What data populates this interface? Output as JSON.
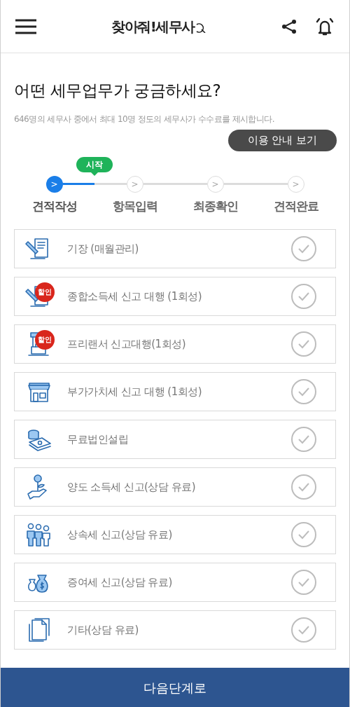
{
  "header": {
    "logo": "찾아줘!세무사"
  },
  "heading": "어떤 세무업무가 궁금하세요?",
  "subtitle": "646명의 세무사 중에서 최대 10명 정도의 세무사가 수수료를 제시합니다.",
  "guide_button": "이용 안내 보기",
  "stepper": {
    "bubble": "시작",
    "steps": [
      {
        "label": "견적작성",
        "mark": ">",
        "selected": true
      },
      {
        "label": "항목입력",
        "mark": ">",
        "selected": false
      },
      {
        "label": "최종확인",
        "mark": ">",
        "selected": false
      },
      {
        "label": "견적완료",
        "mark": ">",
        "selected": false
      }
    ]
  },
  "items": [
    {
      "kind": "ledger",
      "label": "기장 (매월관리)",
      "checked": false
    },
    {
      "kind": "ledger",
      "label": "종합소득세 신고 대행 (1회성)",
      "badge": "할인",
      "checked": false
    },
    {
      "kind": "kiosk",
      "label": "프리랜서 신고대행(1회성)",
      "badge": "할인",
      "checked": false
    },
    {
      "kind": "store",
      "label": "부가가치세 신고 대행 (1회성)",
      "checked": false
    },
    {
      "kind": "money",
      "label": "무료법인설립",
      "checked": false
    },
    {
      "kind": "plant",
      "label": "양도 소득세 신고(상담 유료)",
      "checked": false
    },
    {
      "kind": "people",
      "label": "상속세 신고(상담 유료)",
      "checked": false
    },
    {
      "kind": "bags",
      "label": "증여세 신고(상담 유료)",
      "checked": false
    },
    {
      "kind": "document",
      "label": "기타(상담 유료)",
      "checked": false
    }
  ],
  "next_button": "다음단계로"
}
